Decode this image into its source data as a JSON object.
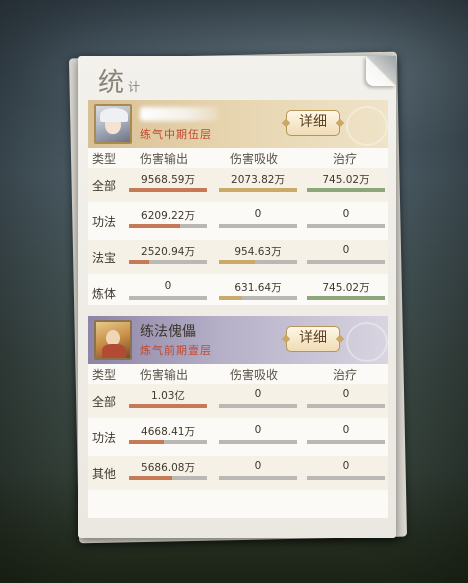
{
  "window": {
    "title": "统",
    "title_sub": "计"
  },
  "columns": [
    "类型",
    "伤害输出",
    "伤害吸收",
    "治疗"
  ],
  "colors": {
    "output_bar": "#c57a55",
    "absorb_bar": "#c9aa68",
    "heal_bar": "#8ea77a",
    "rank_text": "#c2482f"
  },
  "panels": [
    {
      "name": "",
      "rank": "练气中期伍层",
      "detail_label": "详细",
      "avatar_icon": "white-haired-cultivator-portrait",
      "header_color": "#d8c095",
      "rows": [
        {
          "type": "全部",
          "output": "9568.59万",
          "absorb": "2073.82万",
          "heal": "745.02万",
          "output_pct": 1.0,
          "absorb_pct": 1.0,
          "heal_pct": 1.0
        },
        {
          "type": "功法",
          "output": "6209.22万",
          "absorb": "0",
          "heal": "0",
          "output_pct": 0.65,
          "absorb_pct": 0,
          "heal_pct": 0
        },
        {
          "type": "法宝",
          "output": "2520.94万",
          "absorb": "954.63万",
          "heal": "0",
          "output_pct": 0.26,
          "absorb_pct": 0.46,
          "heal_pct": 0
        },
        {
          "type": "炼体",
          "output": "0",
          "absorb": "631.64万",
          "heal": "745.02万",
          "output_pct": 0,
          "absorb_pct": 0.3,
          "heal_pct": 1.0
        }
      ]
    },
    {
      "name": "练法傀儡",
      "rank": "炼气前期壹层",
      "detail_label": "详细",
      "avatar_icon": "training-puppet-portrait",
      "header_color": "#8d84a6",
      "rows": [
        {
          "type": "全部",
          "output": "1.03亿",
          "absorb": "0",
          "heal": "0",
          "output_pct": 1.0,
          "absorb_pct": 0,
          "heal_pct": 0
        },
        {
          "type": "功法",
          "output": "4668.41万",
          "absorb": "0",
          "heal": "0",
          "output_pct": 0.45,
          "absorb_pct": 0,
          "heal_pct": 0
        },
        {
          "type": "其他",
          "output": "5686.08万",
          "absorb": "0",
          "heal": "0",
          "output_pct": 0.55,
          "absorb_pct": 0,
          "heal_pct": 0
        }
      ]
    }
  ]
}
